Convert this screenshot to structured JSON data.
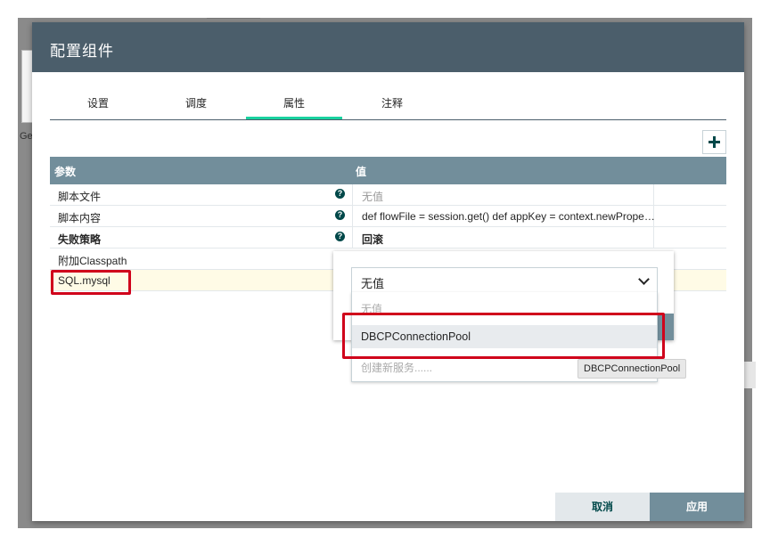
{
  "background": {
    "partial_text": "Ge"
  },
  "dialog": {
    "title": "配置组件",
    "tabs": [
      {
        "label": "设置"
      },
      {
        "label": "调度"
      },
      {
        "label": "属性",
        "active": true
      },
      {
        "label": "注释"
      }
    ],
    "add_button_icon": "plus-icon",
    "table": {
      "headers": {
        "name": "参数",
        "value": "值"
      },
      "rows": [
        {
          "name": "脚本文件",
          "value": "无值",
          "help": "?"
        },
        {
          "name": "脚本内容",
          "value": "def flowFile = session.get() def appKey = context.newPrope…",
          "help": "?"
        },
        {
          "name": "失败策略",
          "value": "回滚",
          "help": "?"
        },
        {
          "name": "附加Classpath",
          "value": ""
        },
        {
          "name": "SQL.mysql",
          "value": ""
        }
      ]
    },
    "combo": {
      "value": "无值",
      "options": [
        {
          "label": "无值"
        },
        {
          "label": "DBCPConnectionPool"
        },
        {
          "label": "创建新服务......"
        }
      ]
    },
    "tooltip": "DBCPConnectionPool",
    "footer": {
      "cancel_label": "取消",
      "apply_label": "应用"
    },
    "colors": {
      "header": "#4b5e6b",
      "table_header": "#728e9b",
      "tab_active": "#1ad2a0",
      "highlight": "#d0021b"
    }
  }
}
